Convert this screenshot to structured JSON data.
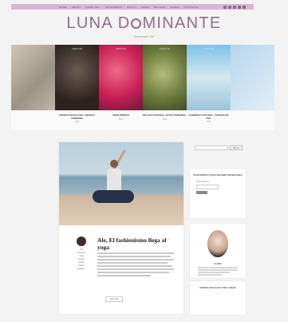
{
  "nav": {
    "items": [
      "HOME",
      "ABOUT",
      "QUIÉN SOY",
      "CATEGORÍAS",
      "ESTILO",
      "MODA",
      "BELLEZA",
      "VIAJES",
      "CONTACTO"
    ],
    "social_icons": [
      "facebook-icon",
      "twitter-icon",
      "instagram-icon",
      "pinterest-icon",
      "mail-icon"
    ]
  },
  "header": {
    "logo_left": "LUNA D",
    "logo_right": "MINANTE",
    "tagline": "Dominant Life"
  },
  "slider": {
    "slides": [
      {
        "category": "",
        "title": "",
        "date": ""
      },
      {
        "category": "LIFESTYLE",
        "title": "ENERGÍA MASCULINA, ENERGÍA FEMENINA",
        "date": "2020"
      },
      {
        "category": "LIFESTYLE",
        "title": "AMOR INFINITO",
        "date": "2020"
      },
      {
        "category": "LIFESTYLE",
        "title": "BELLEZA NATURAL, ESTILO PERSONAL",
        "date": "2020"
      },
      {
        "category": "LIFESTYLE",
        "title": "COSMÉTICA NATURAL, CUIDADO DE PIEL",
        "date": "2020"
      },
      {
        "category": "",
        "title": "",
        "date": ""
      }
    ]
  },
  "post": {
    "title": "Ale, El fashionismo llega al yoga",
    "dots": "• • •",
    "meta_lines": [
      "Ale",
      "Lifestyle",
      "Yoga",
      "Fitness",
      "Moda",
      "Salud",
      "Deporte"
    ],
    "read_more": "Leer más"
  },
  "sidebar": {
    "search_button": "Buscar",
    "subscribe_title": "SUSCRÍBETE PARA RECIBIR NOVEDADES",
    "subscribe_label": "Email address",
    "author_name": "LAURA",
    "bottom_widget_title": "REDES SOCIALES POR LUNAR"
  }
}
